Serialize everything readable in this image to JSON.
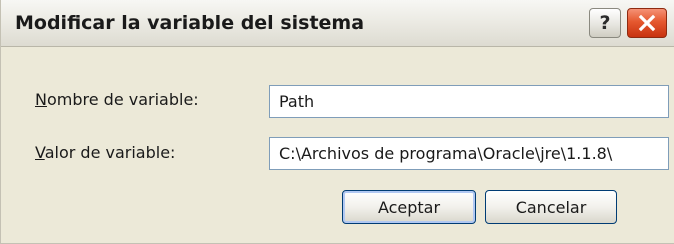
{
  "window": {
    "title": "Modificar la variable del sistema"
  },
  "titlebar": {
    "help_label": "?",
    "help_icon": "question-mark-icon",
    "close_icon": "close-x-icon",
    "close_color": "#d9471d"
  },
  "form": {
    "name_label_accel": "N",
    "name_label_rest": "ombre de variable:",
    "name_value": "Path",
    "value_label_accel": "V",
    "value_label_rest": "alor de variable:",
    "value_value": "C:\\Archivos de programa\\Oracle\\jre\\1.1.8\\"
  },
  "buttons": {
    "accept_label": "Aceptar",
    "cancel_label": "Cancelar"
  }
}
